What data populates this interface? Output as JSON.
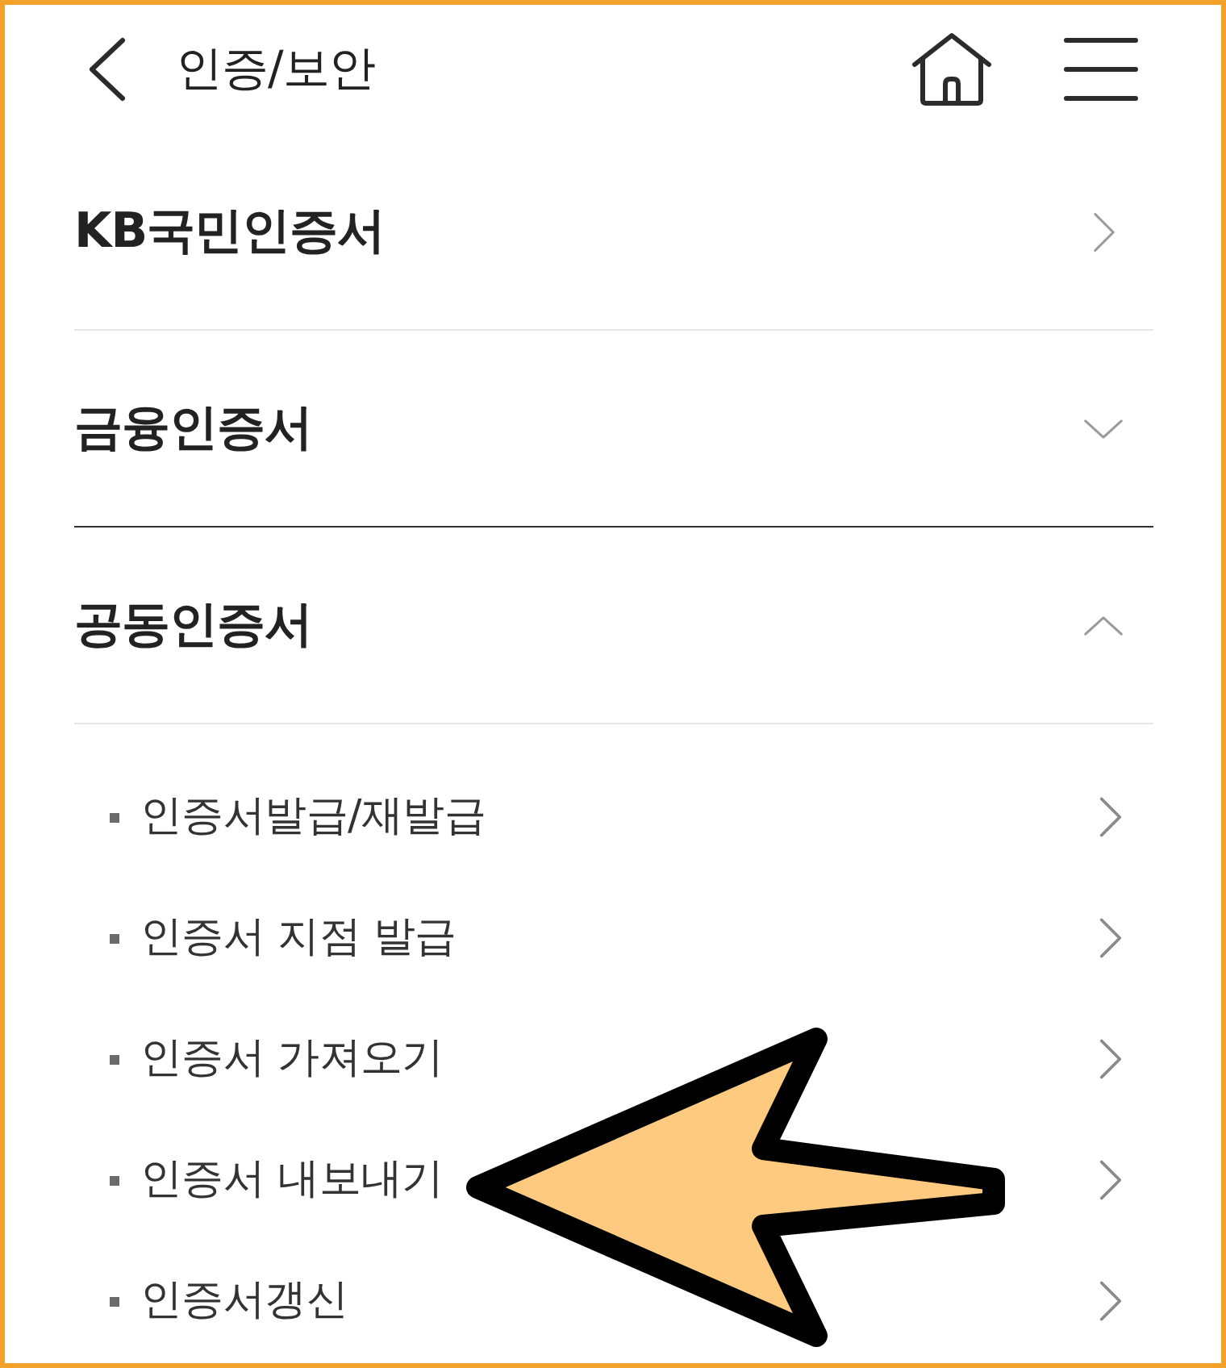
{
  "header": {
    "title": "인증/보안"
  },
  "menu": [
    {
      "label": "KB국민인증서",
      "kind": "link"
    },
    {
      "label": "금융인증서",
      "kind": "accordion",
      "expanded": false
    },
    {
      "label": "공동인증서",
      "kind": "accordion",
      "expanded": true,
      "children": [
        {
          "label": "인증서발급/재발급"
        },
        {
          "label": "인증서 지점 발급"
        },
        {
          "label": "인증서 가져오기"
        },
        {
          "label": "인증서 내보내기"
        },
        {
          "label": "인증서갱신"
        }
      ]
    }
  ]
}
